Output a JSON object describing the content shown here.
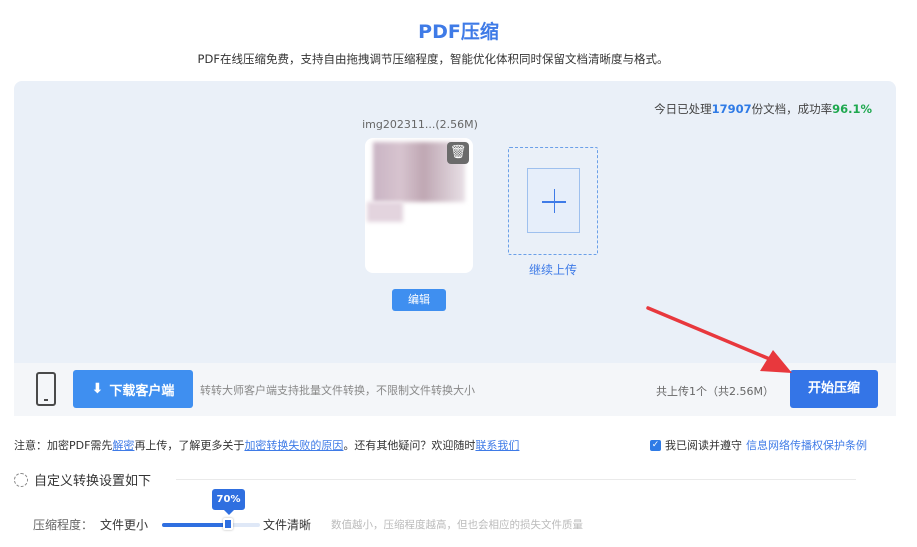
{
  "header": {
    "title": "PDF压缩",
    "subtitle": "PDF在线压缩免费，支持自由拖拽调节压缩程度，智能优化体积同时保留文档清晰度与格式。"
  },
  "stats": {
    "prefix": "今日已处理",
    "processed_count": "17907",
    "middle": "份文档，成功率",
    "success_rate": "96.1%"
  },
  "file": {
    "name": "img202311...(2.56M)",
    "edit_label": "编辑",
    "delete_icon": "trash-icon"
  },
  "upload": {
    "label": "继续上传",
    "icon": "plus-icon"
  },
  "bottom_bar": {
    "phone_icon": "phone-icon",
    "download_label": "下载客户端",
    "download_icon": "download-icon",
    "note": "转转大师客户端支持批量文件转换，不限制文件转换大小",
    "count_text": "共上传1个（共2.56M）",
    "start_label": "开始压缩"
  },
  "notice": {
    "t1": "注意：加密PDF需先",
    "link1": "解密",
    "t2": "再上传，了解更多关于",
    "link2": "加密转换失败的原因",
    "t3": "。还有其他疑问？欢迎随时",
    "link3": "联系我们"
  },
  "agreement": {
    "checked": true,
    "text": "我已阅读并遵守",
    "link": "信息网络传播权保护条例"
  },
  "settings": {
    "heading": "自定义转换设置如下",
    "level_label": "压缩程度：",
    "min_label": "文件更小",
    "max_label": "文件清晰",
    "value_label": "70%",
    "value": 0.7,
    "hint": "数值越小，压缩程度越高，但也会相应的损失文件质量"
  },
  "colors": {
    "accent": "#3f7be7",
    "button": "#3475e7",
    "success": "#1fa84f",
    "annotation_arrow": "#e8383d"
  }
}
